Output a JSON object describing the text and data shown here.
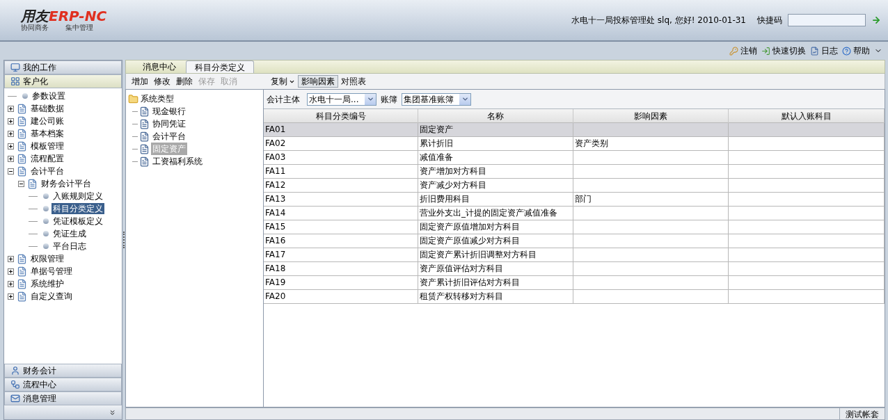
{
  "header": {
    "logo": {
      "brand": "用友",
      "product": "ERP-",
      "suffix": "NC",
      "slogan_left": "协同商务",
      "slogan_right": "集中管理"
    },
    "greeting": "水电十一局投标管理处 slq, 您好! 2010-01-31",
    "shortcut_label": "快捷码"
  },
  "top_links": [
    {
      "label": "注销",
      "kind": "key"
    },
    {
      "label": "快速切换",
      "kind": "switch"
    },
    {
      "label": "日志",
      "kind": "log"
    },
    {
      "label": "帮助",
      "kind": "help"
    }
  ],
  "sidebar": {
    "sections_top": [
      {
        "label": "我的工作",
        "kind": "monitor",
        "selected": false
      },
      {
        "label": "客户化",
        "kind": "grid",
        "selected": true
      }
    ],
    "tree": [
      {
        "label": "参数设置",
        "kind": "leaf",
        "selected": false
      },
      {
        "label": "基础数据",
        "kind": "node",
        "expanded": false,
        "selected": false
      },
      {
        "label": "建公司账",
        "kind": "node",
        "expanded": false,
        "selected": false
      },
      {
        "label": "基本档案",
        "kind": "node",
        "expanded": false,
        "selected": false
      },
      {
        "label": "模板管理",
        "kind": "node",
        "expanded": false,
        "selected": false
      },
      {
        "label": "流程配置",
        "kind": "node",
        "expanded": false,
        "selected": false
      },
      {
        "label": "会计平台",
        "kind": "node",
        "expanded": true,
        "selected": false,
        "children": [
          {
            "label": "财务会计平台",
            "kind": "node",
            "expanded": true,
            "selected": false,
            "children": [
              {
                "label": "入账规则定义",
                "kind": "leaf",
                "selected": false
              },
              {
                "label": "科目分类定义",
                "kind": "leaf",
                "selected": true
              },
              {
                "label": "凭证模板定义",
                "kind": "leaf",
                "selected": false
              },
              {
                "label": "凭证生成",
                "kind": "leaf",
                "selected": false
              },
              {
                "label": "平台日志",
                "kind": "leaf",
                "selected": false
              }
            ]
          }
        ]
      },
      {
        "label": "权限管理",
        "kind": "node",
        "expanded": false,
        "selected": false
      },
      {
        "label": "单据号管理",
        "kind": "node",
        "expanded": false,
        "selected": false
      },
      {
        "label": "系统维护",
        "kind": "node",
        "expanded": false,
        "selected": false
      },
      {
        "label": "自定义查询",
        "kind": "node",
        "expanded": false,
        "selected": false
      }
    ],
    "sections_bottom": [
      {
        "label": "财务会计",
        "kind": "user",
        "selected": false
      },
      {
        "label": "流程中心",
        "kind": "flow",
        "selected": false
      },
      {
        "label": "消息管理",
        "kind": "mail",
        "selected": false
      }
    ]
  },
  "tabs": [
    {
      "label": "消息中心",
      "selected": false
    },
    {
      "label": "科目分类定义",
      "selected": true
    }
  ],
  "toolbar": [
    {
      "label": "增加",
      "disabled": false,
      "pressed": false,
      "dropdown": false
    },
    {
      "label": "修改",
      "disabled": false,
      "pressed": false,
      "dropdown": false
    },
    {
      "label": "删除",
      "disabled": false,
      "pressed": false,
      "dropdown": false
    },
    {
      "label": "保存",
      "disabled": true,
      "pressed": false,
      "dropdown": false
    },
    {
      "label": "取消",
      "disabled": true,
      "pressed": false,
      "dropdown": false
    },
    {
      "label": "复制",
      "disabled": false,
      "pressed": false,
      "dropdown": true,
      "group_start": true
    },
    {
      "label": "影响因素",
      "disabled": false,
      "pressed": true,
      "dropdown": false
    },
    {
      "label": "对照表",
      "disabled": false,
      "pressed": false,
      "dropdown": false
    }
  ],
  "type_tree": {
    "root": "系统类型",
    "items": [
      {
        "label": "现金银行",
        "selected": false
      },
      {
        "label": "协同凭证",
        "selected": false
      },
      {
        "label": "会计平台",
        "selected": false
      },
      {
        "label": "固定资产",
        "selected": true
      },
      {
        "label": "工资福利系统",
        "selected": false
      }
    ]
  },
  "filters": [
    {
      "label": "会计主体",
      "value": "水电十一局..."
    },
    {
      "label": "账簿",
      "value": "集团基准账簿"
    }
  ],
  "table": {
    "columns": [
      "科目分类编号",
      "名称",
      "影响因素",
      "默认入账科目"
    ],
    "rows": [
      {
        "cells": [
          "FA01",
          "固定资产",
          "",
          ""
        ],
        "selected": true
      },
      {
        "cells": [
          "FA02",
          "累计折旧",
          "资产类别",
          ""
        ],
        "selected": false
      },
      {
        "cells": [
          "FA03",
          "减值准备",
          "",
          ""
        ],
        "selected": false
      },
      {
        "cells": [
          "FA11",
          "资产增加对方科目",
          "",
          ""
        ],
        "selected": false
      },
      {
        "cells": [
          "FA12",
          "资产减少对方科目",
          "",
          ""
        ],
        "selected": false
      },
      {
        "cells": [
          "FA13",
          "折旧费用科目",
          "部门",
          ""
        ],
        "selected": false
      },
      {
        "cells": [
          "FA14",
          "营业外支出_计提的固定资产减值准备",
          "",
          ""
        ],
        "selected": false
      },
      {
        "cells": [
          "FA15",
          "固定资产原值增加对方科目",
          "",
          ""
        ],
        "selected": false
      },
      {
        "cells": [
          "FA16",
          "固定资产原值减少对方科目",
          "",
          ""
        ],
        "selected": false
      },
      {
        "cells": [
          "FA17",
          "固定资产累计折旧调整对方科目",
          "",
          ""
        ],
        "selected": false
      },
      {
        "cells": [
          "FA18",
          "资产原值评估对方科目",
          "",
          ""
        ],
        "selected": false
      },
      {
        "cells": [
          "FA19",
          "资产累计折旧评估对方科目",
          "",
          ""
        ],
        "selected": false
      },
      {
        "cells": [
          "FA20",
          "租赁产权转移对方科目",
          "",
          ""
        ],
        "selected": false
      }
    ]
  },
  "status_bar": {
    "account": "测试帐套"
  }
}
